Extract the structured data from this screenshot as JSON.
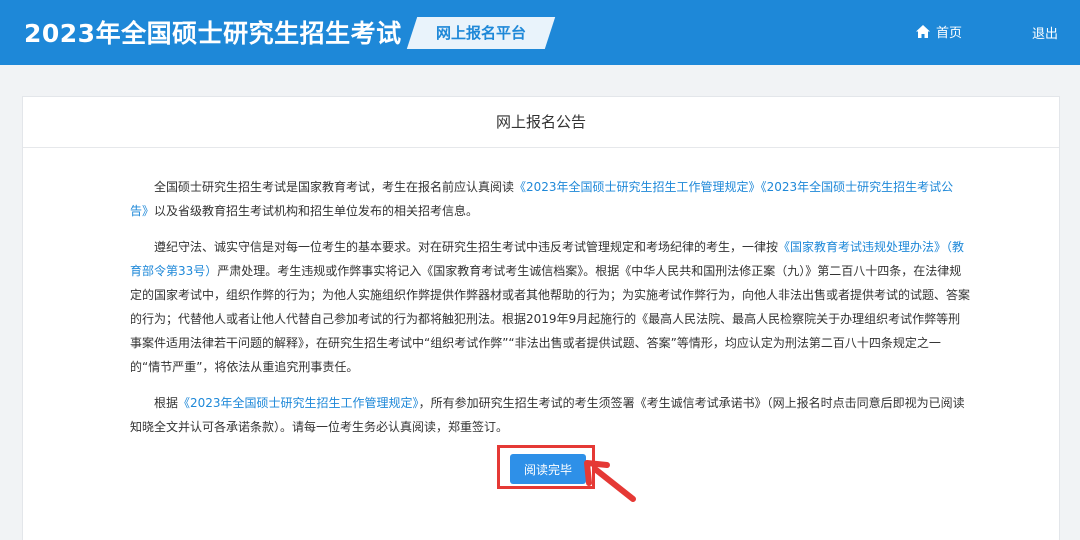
{
  "header": {
    "title": "2023年全国硕士研究生招生考试",
    "platform": "网上报名平台",
    "home_label": "首页",
    "logout_label": "退出",
    "home_icon": "home-icon"
  },
  "panel": {
    "title": "网上报名公告"
  },
  "notice": {
    "p1": {
      "t1": "全国硕士研究生招生考试是国家教育考试，考生在报名前应认真阅读",
      "l1": "《2023年全国硕士研究生招生工作管理规定》",
      "l2": "《2023年全国硕士研究生招生考试公告》",
      "t2": "以及省级教育招生考试机构和招生单位发布的相关招考信息。"
    },
    "p2": {
      "t1": "遵纪守法、诚实守信是对每一位考生的基本要求。对在研究生招生考试中违反考试管理规定和考场纪律的考生，一律按",
      "l1": "《国家教育考试违规处理办法》（教育部令第33号）",
      "t2": "严肃处理。考生违规或作弊事实将记入《国家教育考试考生诚信档案》。根据《中华人民共和国刑法修正案（九）》第二百八十四条，在法律规定的国家考试中，组织作弊的行为；为他人实施组织作弊提供作弊器材或者其他帮助的行为；为实施考试作弊行为，向他人非法出售或者提供考试的试题、答案的行为；代替他人或者让他人代替自己参加考试的行为都将触犯刑法。根据2019年9月起施行的《最高人民法院、最高人民检察院关于办理组织考试作弊等刑事案件适用法律若干问题的解释》，在研究生招生考试中“组织考试作弊”“非法出售或者提供试题、答案”等情形，均应认定为刑法第二百八十四条规定之一的“情节严重”，将依法从重追究刑事责任。"
    },
    "p3": {
      "t1": "根据",
      "l1": "《2023年全国硕士研究生招生工作管理规定》",
      "t2": "，所有参加研究生招生考试的考生须签署《考生诚信考试承诺书》（网上报名时点击同意后即视为已阅读知晓全文并认可各承诺条款）。请每一位考生务必认真阅读，郑重签订。"
    }
  },
  "action": {
    "confirm_label": "阅读完毕"
  },
  "colors": {
    "header_bg": "#1e88d8",
    "link": "#1e88d8",
    "button_bg": "#2e90e8",
    "highlight": "#e53935"
  }
}
